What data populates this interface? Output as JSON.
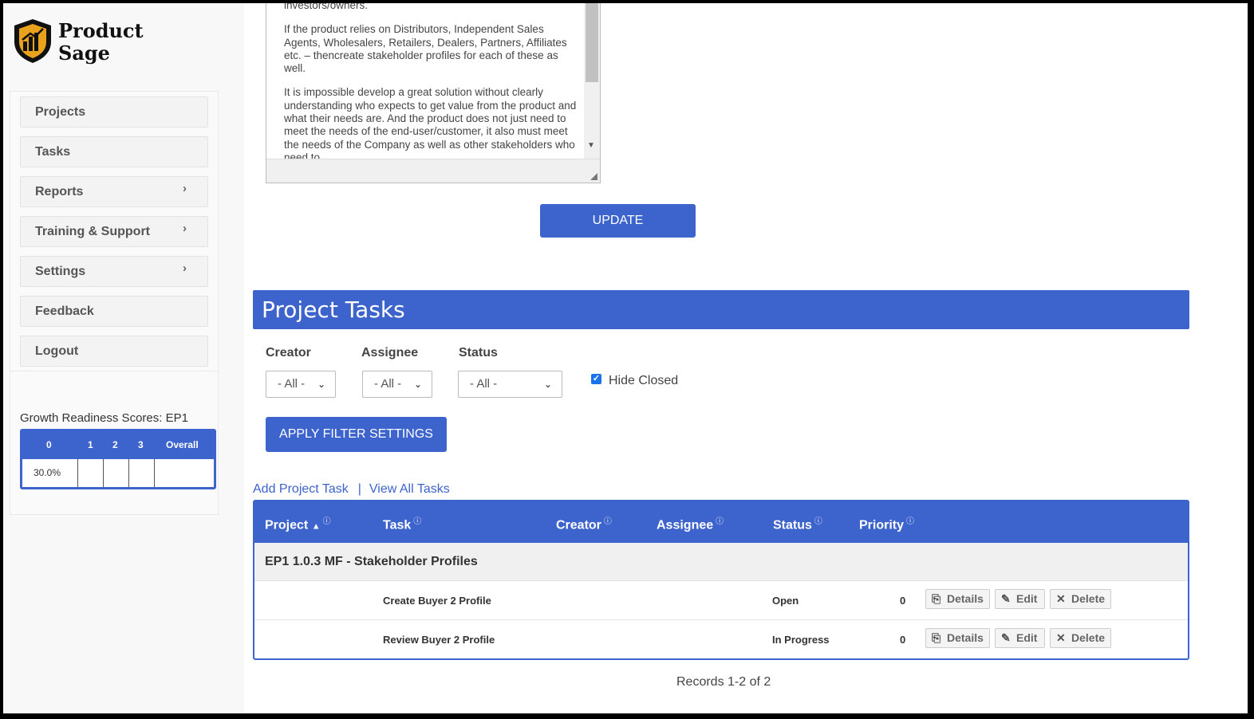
{
  "brand": {
    "name_line1": "Product",
    "name_line2": "Sage"
  },
  "sidebar": {
    "items": [
      {
        "label": "Projects",
        "chevron": ""
      },
      {
        "label": "Tasks",
        "chevron": ""
      },
      {
        "label": "Reports",
        "chevron": "›"
      },
      {
        "label": "Training & Support",
        "chevron": "›"
      },
      {
        "label": "Settings",
        "chevron": "›"
      },
      {
        "label": "Feedback",
        "chevron": ""
      },
      {
        "label": "Logout",
        "chevron": ""
      }
    ],
    "scores": {
      "title": "Growth Readiness Scores: EP1",
      "headers": [
        "0",
        "1",
        "2",
        "3",
        "Overall"
      ],
      "values": [
        "30.0%",
        "",
        "",
        "",
        ""
      ]
    }
  },
  "description": {
    "paragraphs": [
      "investors/owners.",
      "If the product relies on Distributors, Independent Sales Agents, Wholesalers, Retailers, Dealers, Partners, Affiliates etc. – thencreate stakeholder profiles for each of these as well.",
      "It is impossible develop a great solution without clearly understanding who expects to get value from the product and what their needs are. And the product does not just need to meet the needs of the end-user/customer, it also must meet the needs of the Company as well as other stakeholders who need to"
    ]
  },
  "update_label": "UPDATE",
  "tasks": {
    "title": "Project Tasks",
    "filters": {
      "creator_label": "Creator",
      "assignee_label": "Assignee",
      "status_label": "Status",
      "creator_value": "- All -",
      "assignee_value": "- All -",
      "status_value": "- All -",
      "hide_closed_label": "Hide Closed",
      "hide_closed_checked": true,
      "apply_label": "APPLY FILTER SETTINGS"
    },
    "links": {
      "add": "Add Project Task",
      "separator": "|",
      "view_all": "View All Tasks"
    },
    "columns": [
      "Project",
      "Task",
      "Creator",
      "Assignee",
      "Status",
      "Priority"
    ],
    "sort_indicator": "▲",
    "help_icon": "ⓘ",
    "group": "EP1 1.0.3 MF - Stakeholder Profiles",
    "rows": [
      {
        "task": "Create Buyer 2 Profile",
        "status": "Open",
        "priority": "0"
      },
      {
        "task": "Review Buyer 2 Profile",
        "status": "In Progress",
        "priority": "0"
      }
    ],
    "actions": {
      "details": "Details",
      "edit": "Edit",
      "delete": "Delete"
    },
    "records": "Records 1-2 of 2"
  },
  "colors": {
    "accent": "#3d63cc"
  }
}
